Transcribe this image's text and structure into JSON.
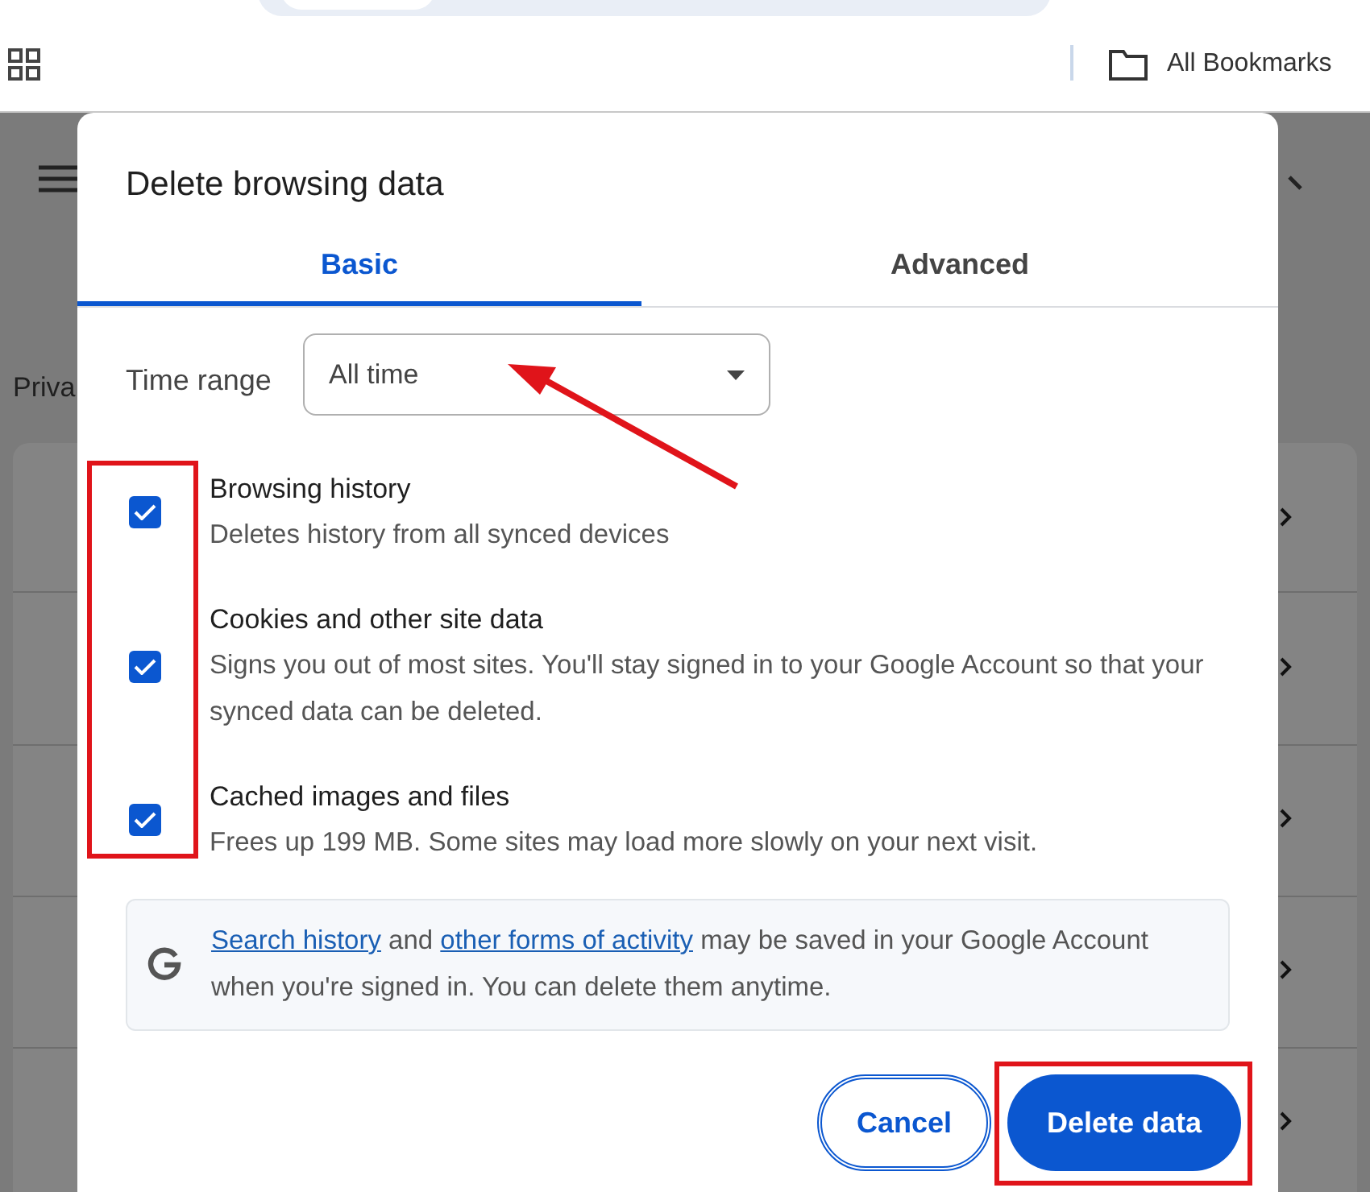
{
  "toolbar": {
    "bookmarks_label": "All Bookmarks"
  },
  "background": {
    "page_heading": "Priva"
  },
  "dialog": {
    "title": "Delete browsing data",
    "tabs": [
      {
        "label": "Basic",
        "selected": true
      },
      {
        "label": "Advanced",
        "selected": false
      }
    ],
    "time_range": {
      "label": "Time range",
      "value": "All time"
    },
    "options": [
      {
        "title": "Browsing history",
        "description": "Deletes history from all synced devices",
        "checked": true
      },
      {
        "title": "Cookies and other site data",
        "description": "Signs you out of most sites. You'll stay signed in to your Google Account so that your synced data can be deleted.",
        "checked": true
      },
      {
        "title": "Cached images and files",
        "description": "Frees up 199 MB. Some sites may load more slowly on your next visit.",
        "checked": true
      }
    ],
    "info": {
      "parts": [
        {
          "kind": "link",
          "text": "Search history"
        },
        {
          "kind": "text",
          "text": " and "
        },
        {
          "kind": "link",
          "text": "other forms of activity"
        },
        {
          "kind": "text",
          "text": " may be saved in your Google Account when you're signed in. You can delete them anytime."
        }
      ]
    },
    "buttons": [
      {
        "label": "Cancel",
        "kind": "secondary"
      },
      {
        "label": "Delete data",
        "kind": "primary"
      }
    ]
  }
}
